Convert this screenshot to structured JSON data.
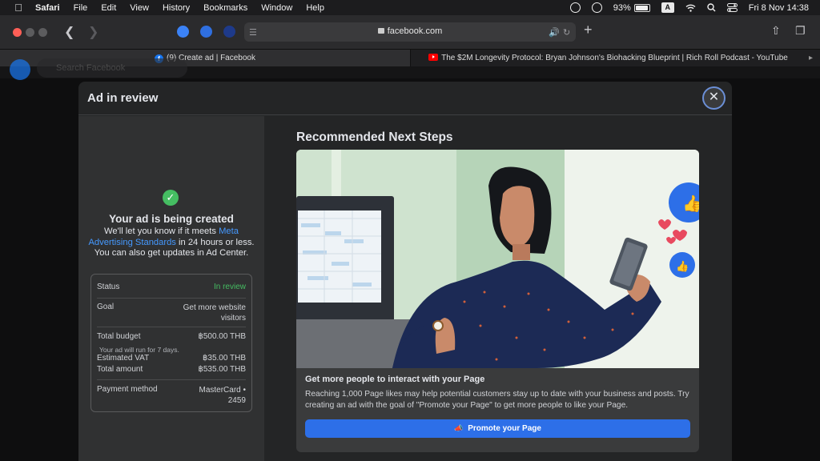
{
  "menubar": {
    "app": "Safari",
    "items": [
      "File",
      "Edit",
      "View",
      "History",
      "Bookmarks",
      "Window",
      "Help"
    ],
    "battery": "93%",
    "input_source": "A",
    "datetime": "Fri 8 Nov  14:38"
  },
  "browser": {
    "url": "facebook.com",
    "tabs": [
      {
        "title": "(9) Create ad | Facebook",
        "active": true
      },
      {
        "title": "The $2M Longevity Protocol: Bryan Johnson's Biohacking Blueprint | Rich Roll Podcast - YouTube",
        "active": false
      }
    ],
    "search_placeholder": "Search Facebook"
  },
  "modal": {
    "title": "Ad in review",
    "status_heading": "Your ad is being created",
    "desc_before": "We'll let you know if it meets ",
    "desc_link": "Meta Advertising Standards",
    "desc_after": " in 24 hours or less. You can also get updates in Ad Center.",
    "summary": {
      "status_label": "Status",
      "status_value": "In review",
      "goal_label": "Goal",
      "goal_value": "Get more website visitors",
      "budget_label": "Total budget",
      "budget_value": "฿500.00 THB",
      "budget_note": "Your ad will run for 7 days.",
      "vat_label": "Estimated VAT",
      "vat_value": "฿35.00 THB",
      "total_label": "Total amount",
      "total_value": "฿535.00 THB",
      "payment_label": "Payment method",
      "payment_value": "MasterCard • 2459"
    },
    "next_steps": {
      "title": "Recommended Next Steps",
      "card_title": "Get more people to interact with your Page",
      "card_desc": "Reaching 1,000 Page likes may help potential customers stay up to date with your business and posts. Try creating an ad with the goal of \"Promote your Page\" to get more people to like your Page.",
      "button": "Promote your Page"
    }
  },
  "colors": {
    "accent": "#2d6fe8",
    "success": "#45bd62",
    "link": "#4599ff"
  }
}
